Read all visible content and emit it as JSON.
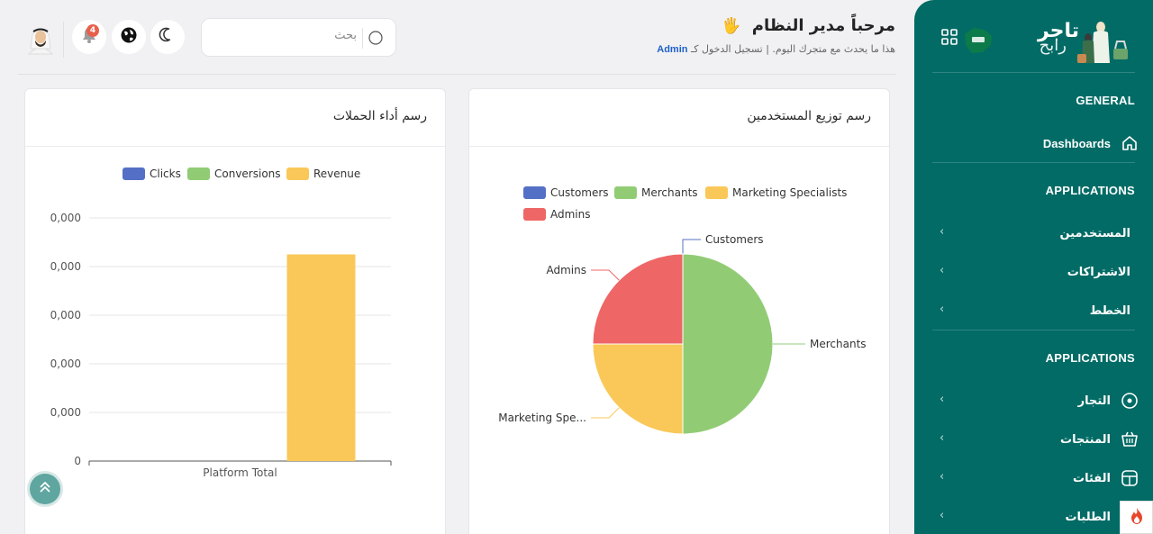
{
  "sidebar": {
    "brand": {
      "name": "تاجر",
      "sub": "رابح"
    },
    "sections": [
      {
        "title": "GENERAL"
      },
      {
        "title": "APPLICATIONS"
      },
      {
        "title": "APPLICATIONS"
      }
    ],
    "items": [
      {
        "label": "Dashboards",
        "icon": "home-icon"
      },
      {
        "label": "المستخدمين"
      },
      {
        "label": "الاشتراكات"
      },
      {
        "label": "الخطط"
      },
      {
        "label": "التجار",
        "icon": "circle-dot-icon"
      },
      {
        "label": "المنتجات",
        "icon": "basket-icon"
      },
      {
        "label": "الفئات",
        "icon": "box-icon"
      },
      {
        "label": "الطلبات",
        "icon": "chat-icon"
      }
    ]
  },
  "header": {
    "welcome": "مرحباً مدير النظام",
    "wave": "🖐",
    "subtitle_before": "هذا ما يحدث مع متجرك اليوم. | تسجيل الدخول كـ",
    "subtitle_user": "Admin",
    "search_placeholder": "بحث",
    "notification_count": "4"
  },
  "cards": {
    "users": {
      "title": "رسم توزيع المستخدمين"
    },
    "campaigns": {
      "title": "رسم أداء الحملات"
    }
  },
  "chart_data": [
    {
      "type": "pie",
      "legend": [
        "Customers",
        "Merchants",
        "Marketing Specialists",
        "Admins"
      ],
      "colors": [
        "#5470c6",
        "#91cc75",
        "#fac858",
        "#ee6666"
      ],
      "slices": [
        {
          "name": "Customers",
          "value": 0,
          "label": "Customers"
        },
        {
          "name": "Merchants",
          "value": 2,
          "label": "Merchants"
        },
        {
          "name": "Marketing Specialists",
          "value": 1,
          "label": "Marketing Spe..."
        },
        {
          "name": "Admins",
          "value": 1,
          "label": "Admins"
        }
      ],
      "legend_position": "top"
    },
    {
      "type": "bar",
      "categories": [
        "Platform Total"
      ],
      "series": [
        {
          "name": "Clicks",
          "values": [
            0
          ],
          "color": "#5470c6"
        },
        {
          "name": "Conversions",
          "values": [
            0
          ],
          "color": "#91cc75"
        },
        {
          "name": "Revenue",
          "values": [
            0.85
          ],
          "color": "#fac858"
        }
      ],
      "ytick_labels": [
        "0,000",
        "0,000",
        "0,000",
        "0,000",
        "0,000",
        "0"
      ],
      "ylim": [
        0,
        1
      ],
      "legend_position": "top"
    }
  ]
}
